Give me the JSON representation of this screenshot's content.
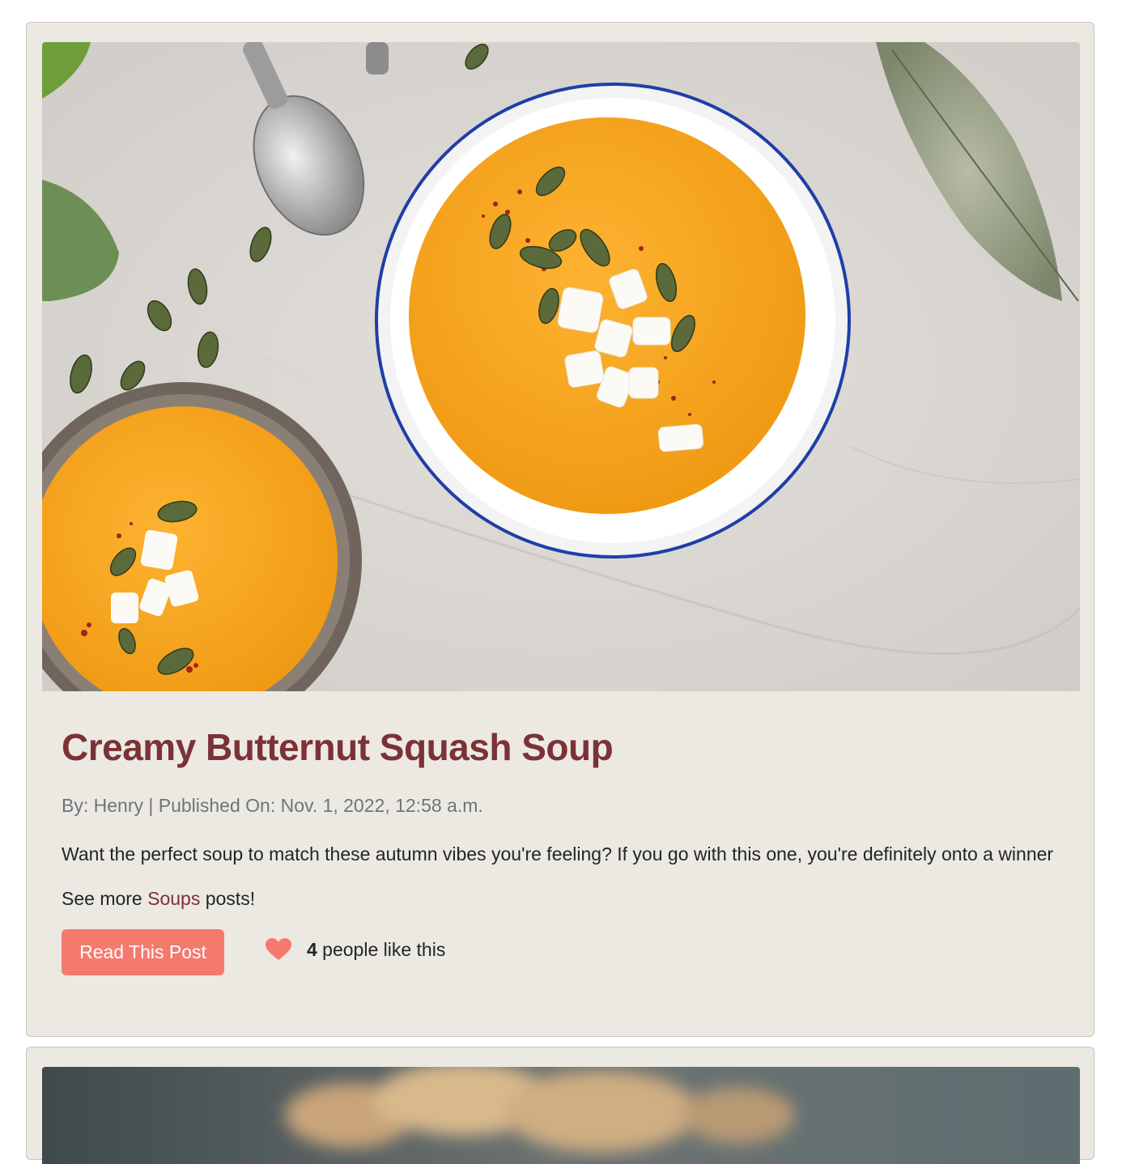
{
  "posts": [
    {
      "image_alt": "Two bowls of butternut squash soup topped with pumpkin seeds and feta",
      "title": "Creamy Butternut Squash Soup",
      "meta": "By: Henry | Published On: Nov. 1, 2022, 12:58 a.m.",
      "excerpt": "Want the perfect soup to match these autumn vibes you're feeling? If you go with this one, you're definitely onto a winner",
      "see_more_prefix": "See more ",
      "category": "Soups",
      "see_more_suffix": " posts!",
      "read_label": "Read This Post",
      "likes": "4",
      "likes_suffix": " people like this",
      "like_icon": "heart-icon"
    }
  ],
  "colors": {
    "card_bg": "#ece9e2",
    "title": "#7b3236",
    "button": "#f47a6e",
    "meta": "#6c757d"
  }
}
